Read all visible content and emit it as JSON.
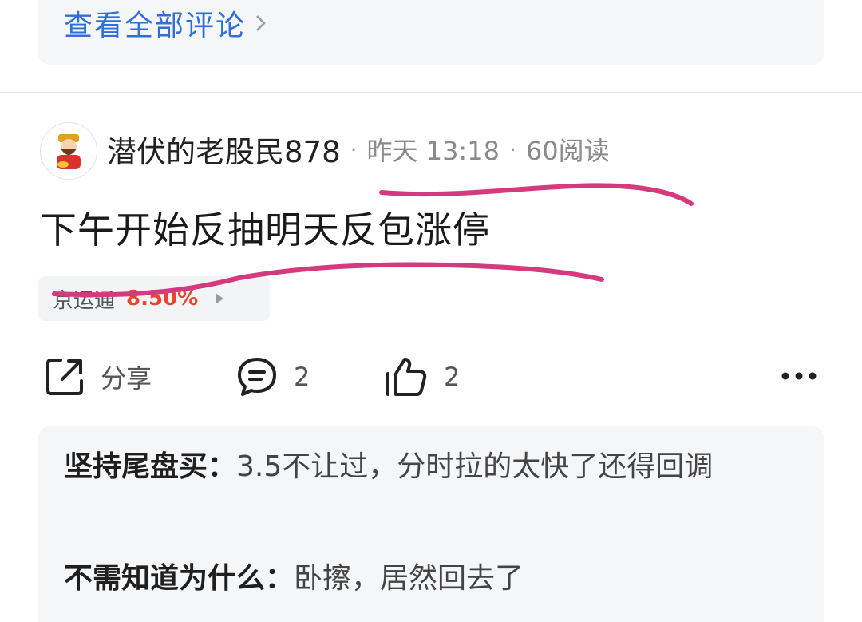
{
  "prev_post": {
    "view_all_comments": "查看全部评论"
  },
  "post": {
    "author": "潜伏的老股民878",
    "time": "昨天 13:18",
    "reads": "60阅读",
    "separator": "·",
    "content": "下午开始反抽明天反包涨停",
    "stock": {
      "name": "京运通",
      "change": "8.50%"
    },
    "actions": {
      "share_label": "分享",
      "comment_count": "2",
      "like_count": "2"
    }
  },
  "comments": [
    {
      "author": "坚持尾盘买：",
      "text": "3.5不让过，分时拉的太快了还得回调"
    },
    {
      "author": "不需知道为什么：",
      "text": "卧擦，居然回去了"
    }
  ],
  "colors": {
    "link_blue": "#2f6fd6",
    "stock_red": "#e8452c",
    "annotation_magenta": "#d63a7e"
  }
}
